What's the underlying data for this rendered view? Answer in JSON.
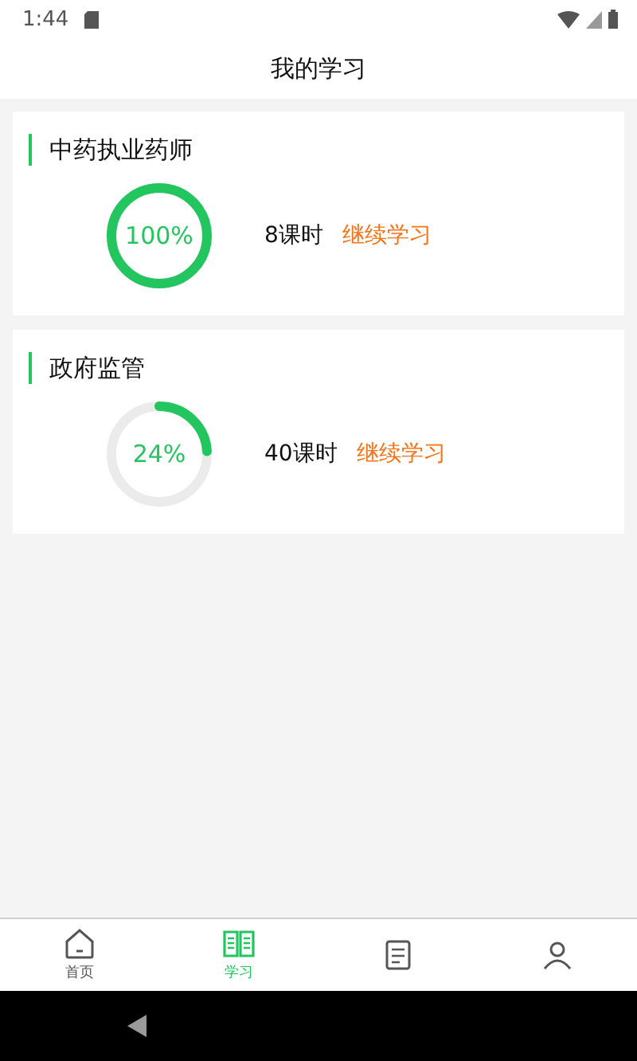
{
  "status_bar": {
    "time": "1:44"
  },
  "header": {
    "title": "我的学习"
  },
  "courses": [
    {
      "title": "中药执业药师",
      "level": 1,
      "percent": "100%",
      "hours": "8课时",
      "action": "继续学习"
    },
    {
      "title": "政府监管",
      "level": 0.24,
      "percent": "24%",
      "hours": "40课时",
      "action": "继续学习"
    }
  ],
  "tabs": [
    {
      "kind": "home",
      "label": "首页",
      "selected": false
    },
    {
      "kind": "study",
      "label": "学习",
      "selected": true
    },
    {
      "kind": "document",
      "selected": false
    },
    {
      "kind": "person",
      "selected": false
    }
  ]
}
